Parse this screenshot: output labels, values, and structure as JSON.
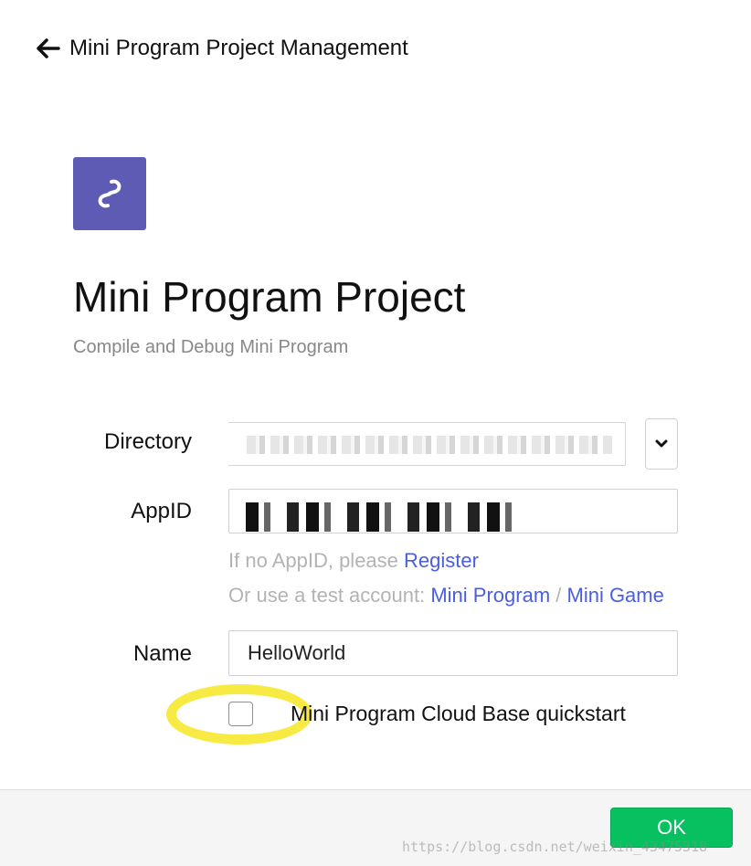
{
  "header": {
    "back_label": "Mini Program Project Management"
  },
  "app": {
    "logo_icon": "mini-program-logo-icon",
    "title": "Mini Program Project",
    "subtitle": "Compile and Debug Mini Program"
  },
  "form": {
    "directory": {
      "label": "Directory",
      "value": "",
      "value_note": "pixelated/obscured"
    },
    "appid": {
      "label": "AppID",
      "value": "",
      "value_note": "pixelated/obscured",
      "hint_prefix": "If no AppID, please ",
      "register_link": "Register",
      "test_prefix": "Or use a test account: ",
      "mini_program_link": "Mini Program",
      "separator": " / ",
      "mini_game_link": "Mini Game"
    },
    "name": {
      "label": "Name",
      "value": "HelloWorld"
    },
    "quickstart": {
      "label": "Mini Program Cloud Base quickstart",
      "checked": false
    }
  },
  "footer": {
    "ok_label": "OK",
    "watermark": "https://blog.csdn.net/weixin_43475318"
  },
  "colors": {
    "brand_purple": "#5e5bb4",
    "link_blue": "#4a5ee0",
    "ok_green": "#07c160",
    "highlight_yellow": "#f7ea42"
  }
}
